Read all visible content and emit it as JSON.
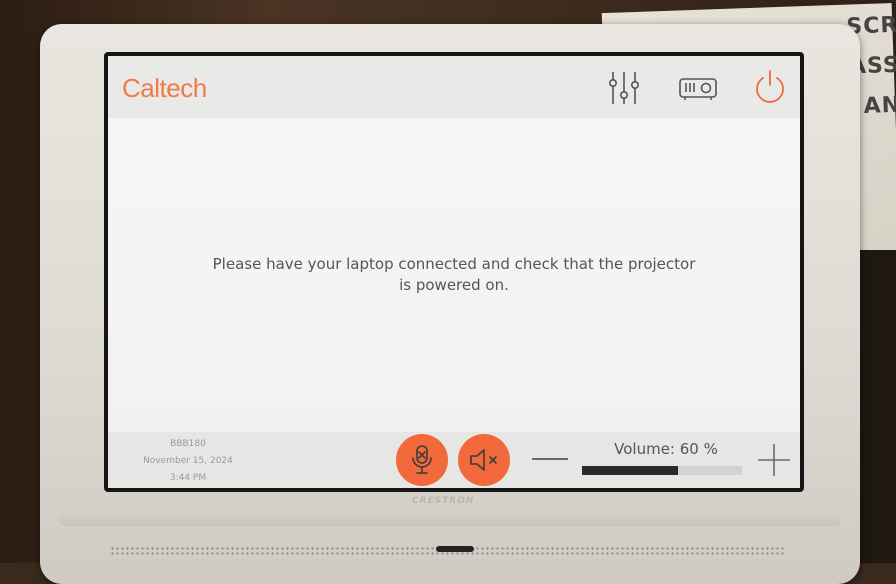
{
  "header": {
    "logo_text": "Caltech",
    "icons": [
      "audio-settings-icon",
      "projector-icon",
      "power-icon"
    ]
  },
  "main": {
    "message_line1": "Please have your laptop connected and check that the projector",
    "message_line2": "is powered on."
  },
  "footer": {
    "room": "BBB180",
    "date": "November 15, 2024",
    "time": "3:44 PM",
    "mic_mute_icon": "microphone-mute-icon",
    "speaker_mute_icon": "speaker-mute-icon",
    "volume_label": "Volume: 60 %",
    "volume_level": 0.6
  },
  "device": {
    "brand": "CRESTRON"
  },
  "background": {
    "paper_text": [
      "SCR",
      "ASS",
      "AN"
    ]
  },
  "colors": {
    "accent": "#f26a3c",
    "logo": "#f07a4a"
  }
}
